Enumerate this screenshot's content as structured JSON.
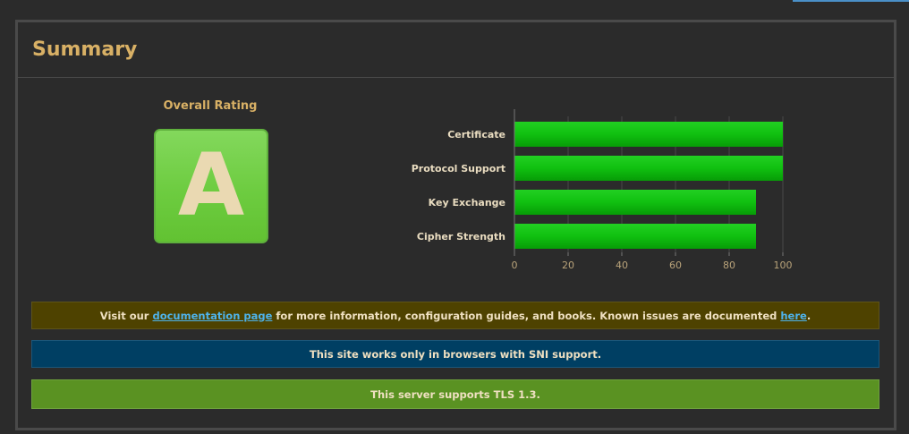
{
  "summary": {
    "title": "Summary",
    "overall_rating_label": "Overall Rating",
    "grade": "A",
    "grade_color": "#6dcc40"
  },
  "chart_data": {
    "type": "bar",
    "orientation": "horizontal",
    "categories": [
      "Certificate",
      "Protocol Support",
      "Key Exchange",
      "Cipher Strength"
    ],
    "values": [
      100,
      100,
      90,
      90
    ],
    "xlim": [
      0,
      100
    ],
    "ticks": [
      0,
      20,
      40,
      60,
      80,
      100
    ],
    "grid": true,
    "bar_color": "#10c010",
    "title": "",
    "xlabel": "",
    "ylabel": ""
  },
  "notices": {
    "docs": {
      "text_1": "Visit our ",
      "link_1": "documentation page",
      "text_2": " for more information, configuration guides, and books. Known issues are documented ",
      "link_2": "here",
      "text_3": ".",
      "background": "#4e4200"
    },
    "sni": {
      "text": "This site works only in browsers with SNI support.",
      "background": "#003f63"
    },
    "tls": {
      "text": "This server supports TLS 1.3.",
      "background": "#5a9222"
    }
  }
}
